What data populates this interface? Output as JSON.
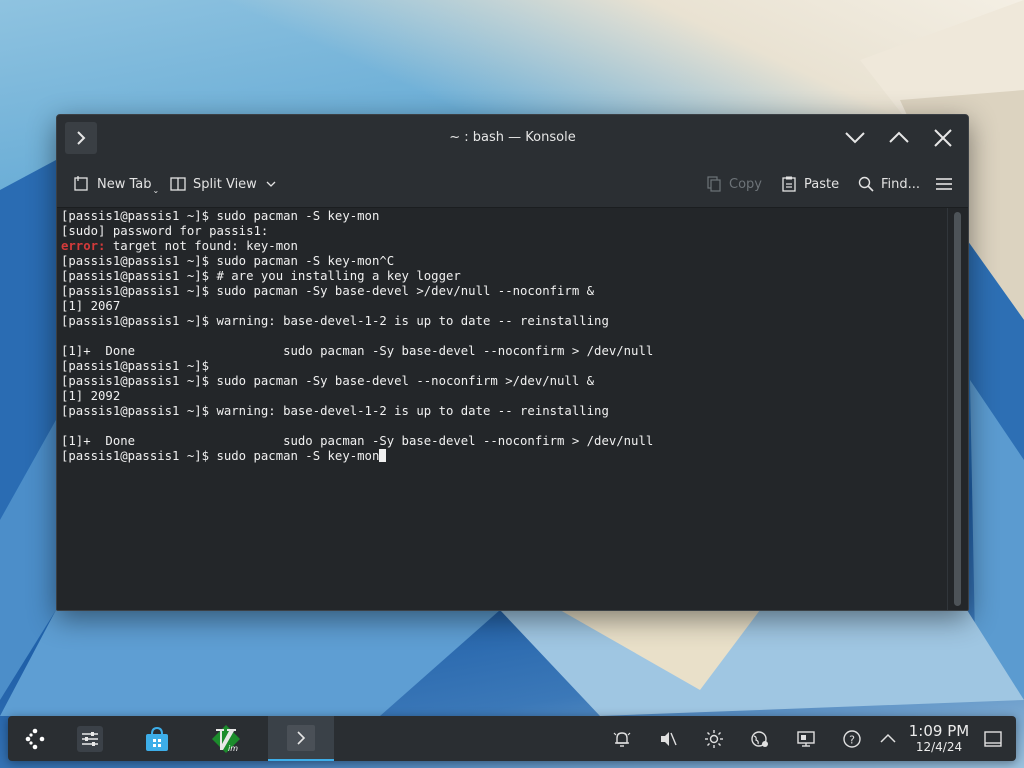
{
  "window": {
    "title": "~ : bash — Konsole",
    "toolbar": {
      "new_tab": "New Tab",
      "split_view": "Split View",
      "copy": "Copy",
      "paste": "Paste",
      "find": "Find..."
    }
  },
  "terminal": {
    "lines": [
      {
        "text": "[passis1@passis1 ~]$ sudo pacman -S key-mon"
      },
      {
        "text": "[sudo] password for passis1:"
      },
      {
        "prefix": "error:",
        "text": " target not found: key-mon"
      },
      {
        "text": "[passis1@passis1 ~]$ sudo pacman -S key-mon^C"
      },
      {
        "text": "[passis1@passis1 ~]$ # are you installing a key logger"
      },
      {
        "text": "[passis1@passis1 ~]$ sudo pacman -Sy base-devel >/dev/null --noconfirm &"
      },
      {
        "text": "[1] 2067"
      },
      {
        "text": "[passis1@passis1 ~]$ warning: base-devel-1-2 is up to date -- reinstalling"
      },
      {
        "text": ""
      },
      {
        "text": "[1]+  Done                    sudo pacman -Sy base-devel --noconfirm > /dev/null"
      },
      {
        "text": "[passis1@passis1 ~]$"
      },
      {
        "text": "[passis1@passis1 ~]$ sudo pacman -Sy base-devel --noconfirm >/dev/null &"
      },
      {
        "text": "[1] 2092"
      },
      {
        "text": "[passis1@passis1 ~]$ warning: base-devel-1-2 is up to date -- reinstalling"
      },
      {
        "text": ""
      },
      {
        "text": "[1]+  Done                    sudo pacman -Sy base-devel --noconfirm > /dev/null"
      },
      {
        "text": "[passis1@passis1 ~]$ sudo pacman -S key-mon",
        "cursor": true
      }
    ],
    "error_color": "#d43a3a"
  },
  "taskbar": {
    "apps": [
      {
        "name": "application-launcher-icon"
      },
      {
        "name": "system-settings-icon"
      },
      {
        "name": "discover-store-icon"
      },
      {
        "name": "vim-icon"
      },
      {
        "name": "konsole-icon",
        "active": true
      }
    ],
    "tray": [
      "notifications-icon",
      "volume-muted-icon",
      "brightness-icon",
      "network-icon",
      "display-icon",
      "help-icon",
      "show-hidden-icon"
    ],
    "clock": {
      "time": "1:09 PM",
      "date": "12/4/24"
    },
    "accent": "#3daee9"
  }
}
